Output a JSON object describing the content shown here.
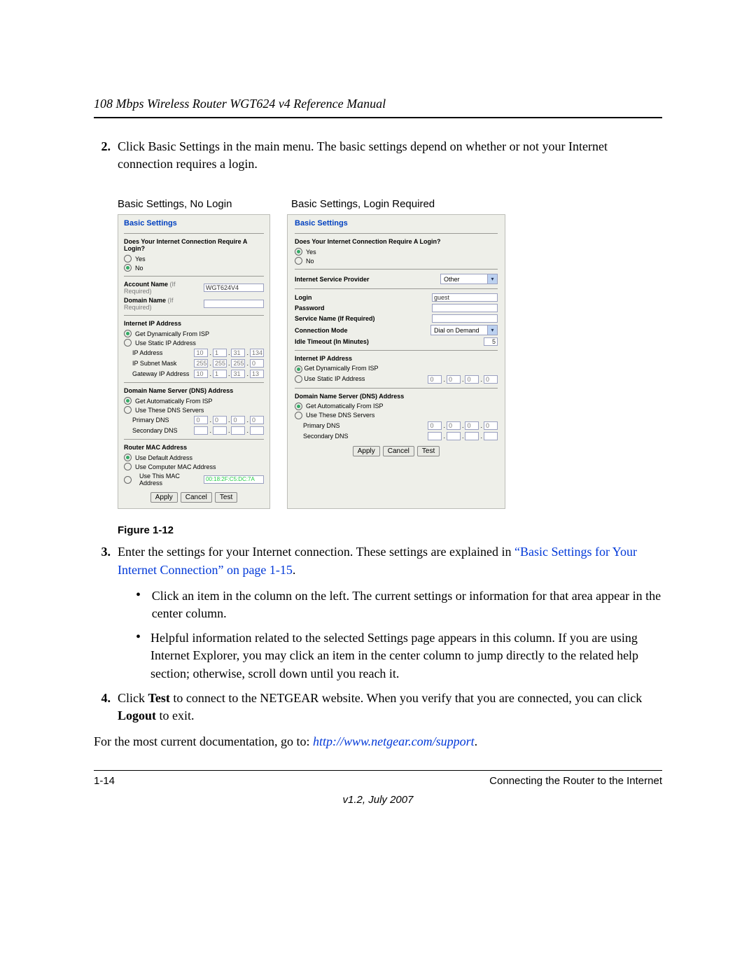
{
  "header": "108 Mbps Wireless Router WGT624 v4 Reference Manual",
  "step2": {
    "num": "2.",
    "text": "Click Basic Settings in the main menu. The basic settings depend on whether or not your Internet connection requires a login."
  },
  "shot_labels": {
    "left": "Basic Settings, No Login",
    "right": "Basic Settings, Login Required"
  },
  "panelA": {
    "title": "Basic Settings",
    "q": "Does Your Internet Connection Require A Login?",
    "yes": "Yes",
    "no": "No",
    "account_label": "Account Name",
    "ifreq": "(If Required)",
    "account_value": "WGT624V4",
    "domain_label": "Domain Name",
    "ip_head": "Internet IP Address",
    "ip_dyn": "Get Dynamically From ISP",
    "ip_static": "Use Static IP Address",
    "ip_addr_label": "IP Address",
    "ip_addr": [
      "10",
      "1",
      "31",
      "134"
    ],
    "subnet_label": "IP Subnet Mask",
    "subnet": [
      "255",
      "255",
      "255",
      "0"
    ],
    "gw_label": "Gateway IP Address",
    "gw": [
      "10",
      "1",
      "31",
      "13"
    ],
    "dns_head": "Domain Name Server (DNS) Address",
    "dns_auto": "Get Automatically From ISP",
    "dns_these": "Use These DNS Servers",
    "pdns": "Primary DNS",
    "pdns_v": [
      "0",
      "0",
      "0",
      "0"
    ],
    "sdns": "Secondary DNS",
    "mac_head": "Router MAC Address",
    "mac_def": "Use Default Address",
    "mac_comp": "Use Computer MAC Address",
    "mac_this": "Use This MAC Address",
    "mac_val": "00:18:2F:C5:DC:7A",
    "apply": "Apply",
    "cancel": "Cancel",
    "test": "Test"
  },
  "panelB": {
    "title": "Basic Settings",
    "q": "Does Your Internet Connection Require A Login?",
    "yes": "Yes",
    "no": "No",
    "isp_label": "Internet Service Provider",
    "isp_value": "Other",
    "login_label": "Login",
    "login_value": "guest",
    "pw_label": "Password",
    "svc_label": "Service Name (If Required)",
    "conn_label": "Connection Mode",
    "conn_value": "Dial on Demand",
    "idle_label": "Idle Timeout (In Minutes)",
    "idle_value": "5",
    "ip_head": "Internet IP Address",
    "ip_dyn": "Get Dynamically From ISP",
    "ip_static": "Use Static IP Address",
    "ip_static_v": [
      "0",
      "0",
      "0",
      "0"
    ],
    "dns_head": "Domain Name Server (DNS) Address",
    "dns_auto": "Get Automatically From ISP",
    "dns_these": "Use These DNS Servers",
    "pdns": "Primary DNS",
    "pdns_v": [
      "0",
      "0",
      "0",
      "0"
    ],
    "sdns": "Secondary DNS",
    "apply": "Apply",
    "cancel": "Cancel",
    "test": "Test"
  },
  "figure": "Figure 1-12",
  "step3": {
    "num": "3.",
    "text_a": "Enter the settings for your Internet connection. These settings are explained in ",
    "link": "“Basic Settings for Your Internet Connection” on page 1-15",
    "text_b": "."
  },
  "bullet1": "Click an item in the column on the left. The current settings or information for that area appear in the center column.",
  "bullet2": "Helpful information related to the selected Settings page appears in this column. If you are using Internet Explorer, you may click an item in the center column to jump directly to the related help section; otherwise, scroll down until you reach it.",
  "step4": {
    "num": "4.",
    "a": "Click ",
    "b": "Test",
    "c": " to connect to the NETGEAR website. When you verify that you are connected, you can click ",
    "d": "Logout",
    "e": " to exit."
  },
  "doc_note_a": "For the most current documentation, go to: ",
  "doc_note_link": "http://www.netgear.com/support",
  "doc_note_c": ".",
  "footer": {
    "pagenum": "1-14",
    "section": "Connecting the Router to the Internet",
    "version": "v1.2, July 2007"
  }
}
